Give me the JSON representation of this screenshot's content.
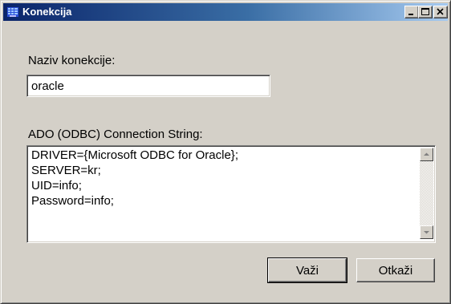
{
  "window": {
    "title": "Konekcija",
    "icon": "database-grid-icon",
    "controls": [
      "minimize-icon",
      "maximize-icon",
      "close-icon"
    ]
  },
  "form": {
    "name_label": "Naziv konekcije:",
    "name_value": "oracle",
    "connection_label": "ADO (ODBC) Connection String:",
    "connection_value": "DRIVER={Microsoft ODBC for Oracle};\nSERVER=kr;\nUID=info;\nPassword=info;"
  },
  "buttons": {
    "ok_label": "Važi",
    "cancel_label": "Otkaži"
  },
  "colors": {
    "face": "#d4d0c8",
    "title_start": "#0a246a",
    "title_end": "#a6caf0"
  }
}
